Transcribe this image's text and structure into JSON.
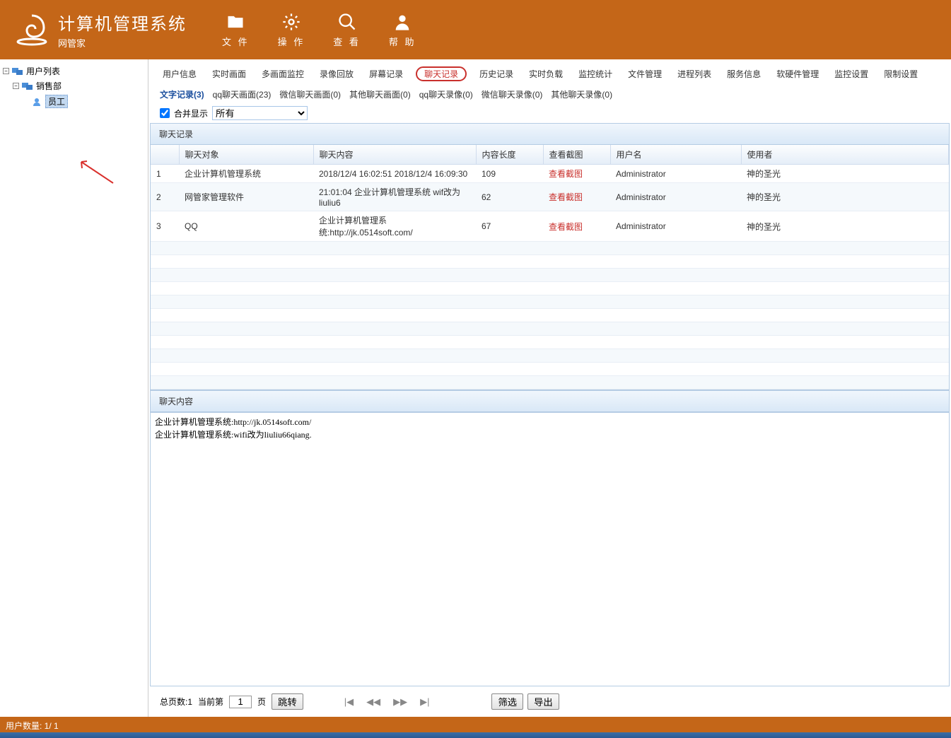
{
  "header": {
    "app_title": "计算机管理系统",
    "logo_sub": "网管家",
    "toolbar": [
      {
        "label": "文 件",
        "icon": "folder"
      },
      {
        "label": "操 作",
        "icon": "gear"
      },
      {
        "label": "查 看",
        "icon": "search"
      },
      {
        "label": "帮 助",
        "icon": "person"
      }
    ]
  },
  "sidebar": {
    "root": "用户列表",
    "dept": "销售部",
    "employee": "员工"
  },
  "nav_tabs": [
    "用户信息",
    "实时画面",
    "多画面监控",
    "录像回放",
    "屏幕记录",
    "聊天记录",
    "历史记录",
    "实时负载",
    "监控统计",
    "文件管理",
    "进程列表",
    "服务信息",
    "软硬件管理",
    "监控设置",
    "限制设置"
  ],
  "nav_highlighted_index": 5,
  "sub_tabs": [
    "文字记录(3)",
    "qq聊天画面(23)",
    "微信聊天画面(0)",
    "其他聊天画面(0)",
    "qq聊天录像(0)",
    "微信聊天录像(0)",
    "其他聊天录像(0)"
  ],
  "sub_active_index": 0,
  "filter": {
    "merge_label": "合并显示",
    "select_value": "所有"
  },
  "table": {
    "section_title": "聊天记录",
    "columns": [
      "",
      "聊天对象",
      "聊天内容",
      "内容长度",
      "查看截图",
      "用户名",
      "使用者"
    ],
    "rows": [
      {
        "idx": "1",
        "target": "企业计算机管理系统",
        "content": "2018/12/4 16:02:51  2018/12/4 16:09:30",
        "len": "109",
        "screenshot": "查看截图",
        "user": "Administrator",
        "operator": "神的圣光"
      },
      {
        "idx": "2",
        "target": "网管家管理软件",
        "content": "21:01:04 企业计算机管理系统 wif改为liuliu6",
        "len": "62",
        "screenshot": "查看截图",
        "user": "Administrator",
        "operator": "神的圣光"
      },
      {
        "idx": "3",
        "target": "QQ",
        "content": "企业计算机管理系统:http://jk.0514soft.com/",
        "len": "67",
        "screenshot": "查看截图",
        "user": "Administrator",
        "operator": "神的圣光"
      }
    ],
    "content_section_title": "聊天内容",
    "content_text": "企业计算机管理系统:http://jk.0514soft.com/\n企业计算机管理系统:wifi改为liuliu66qiang."
  },
  "pager": {
    "total_label": "总页数:1",
    "current_prefix": "当前第",
    "current_value": "1",
    "current_suffix": "页",
    "jump": "跳转",
    "filter": "筛选",
    "export": "导出"
  },
  "status": "用户数量: 1/ 1"
}
